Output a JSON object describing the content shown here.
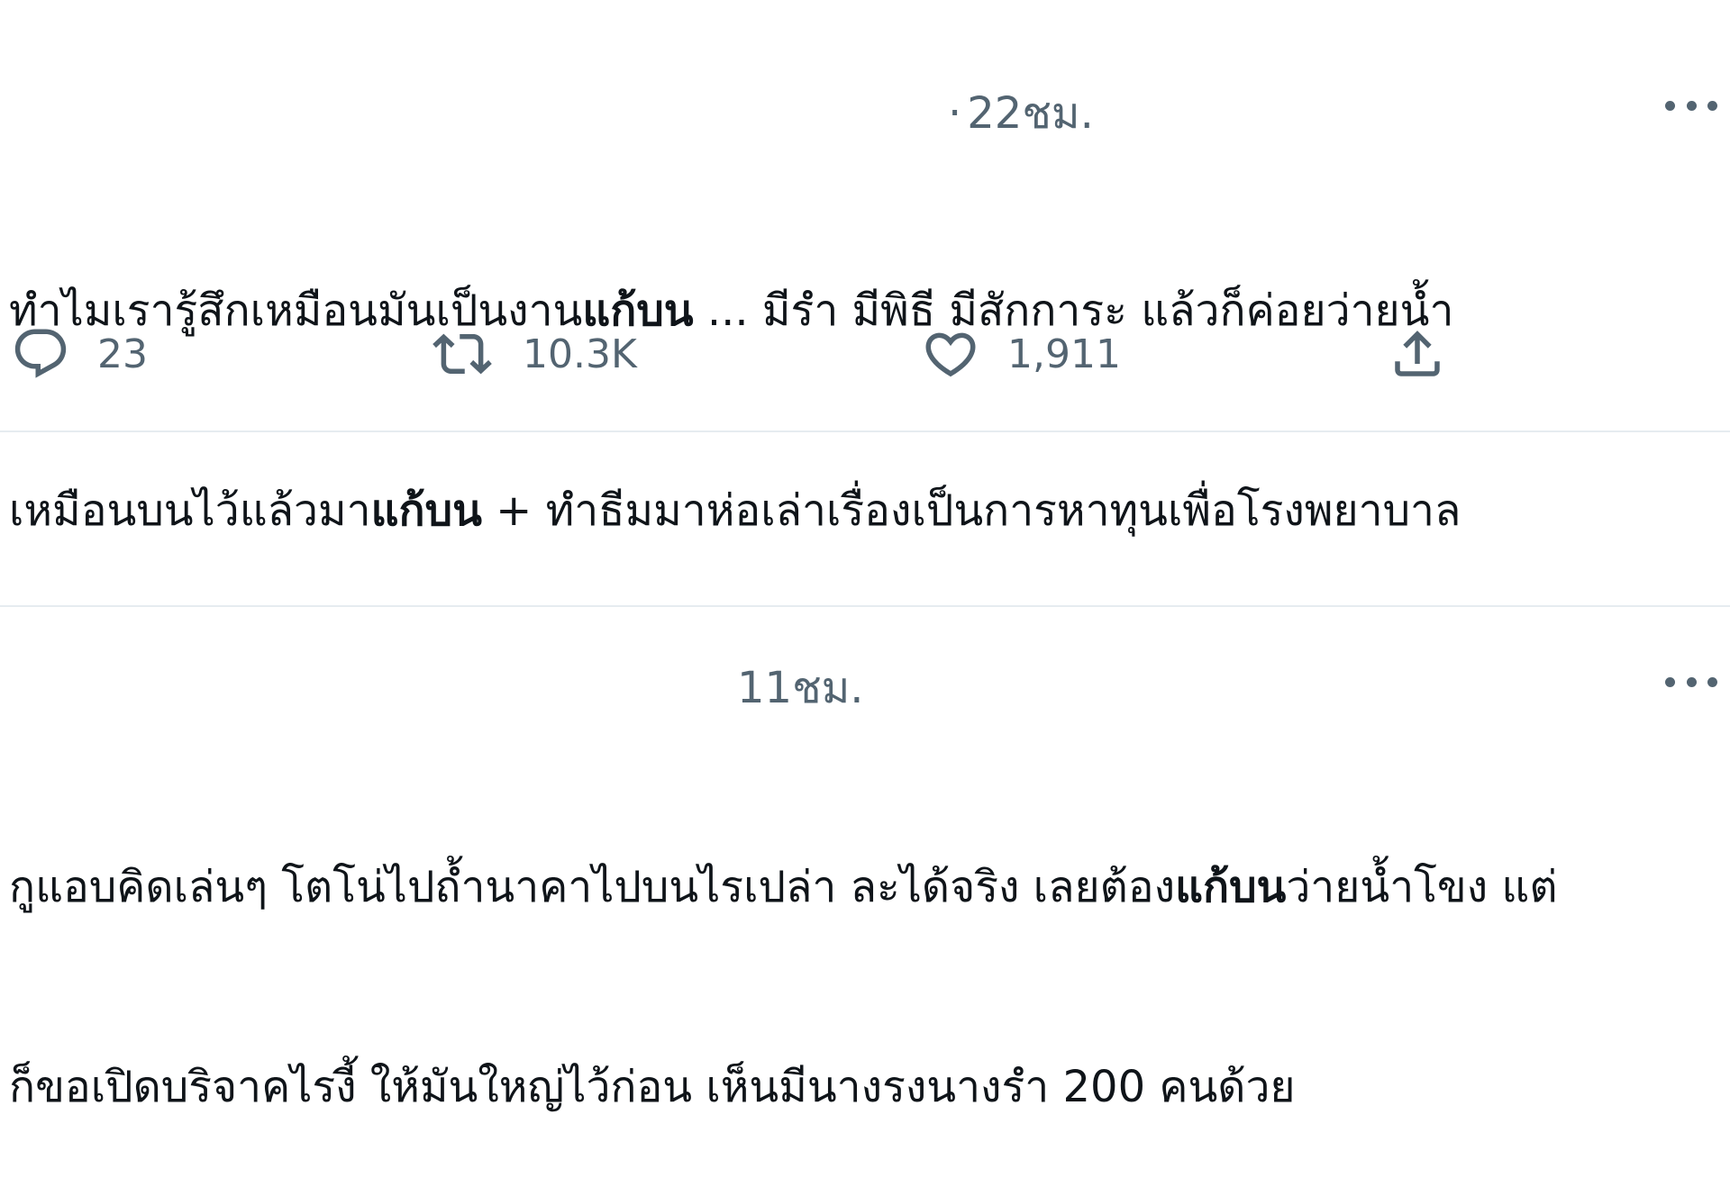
{
  "tweets": [
    {
      "time_separator": "·",
      "time": "22ชม.",
      "lines": [
        [
          {
            "text": "ทำไมเรารู้สึกเหมือนมันเป็นงาน",
            "bold": false
          },
          {
            "text": "แก้บน",
            "bold": true
          },
          {
            "text": " ... มีรำ มีพิธี มีสักการะ แล้วก็ค่อยว่ายน้ำ",
            "bold": false
          }
        ],
        [
          {
            "text": "เหมือนบนไว้แล้วมา",
            "bold": false
          },
          {
            "text": "แก้บน",
            "bold": true
          },
          {
            "text": " + ทำธีมมาห่อเล่าเรื่องเป็นการหาทุนเพื่อโรงพยาบาล",
            "bold": false
          }
        ]
      ],
      "actions": {
        "replies": "23",
        "retweets": "10.3K",
        "likes": "1,911"
      }
    },
    {
      "time": "11ชม.",
      "lines": [
        [
          {
            "text": "กูแอบคิดเล่นๆ โตโน่ไปถ้ำนาคาไปบนไรเปล่า ละได้จริง เลยต้อง",
            "bold": false
          },
          {
            "text": "แก้บน",
            "bold": true
          },
          {
            "text": "ว่ายน้ำโขง แต่",
            "bold": false
          }
        ],
        [
          {
            "text": "ก็ขอเปิดบริจาคไรงี้ ให้มันใหญ่ไว้ก่อน เห็นมีนางรงนางรำ 200 คนด้วย",
            "bold": false
          }
        ]
      ]
    }
  ],
  "icons": {
    "reply": "reply-icon",
    "retweet": "retweet-icon",
    "like": "heart-icon",
    "share": "share-icon",
    "more": "more-icon"
  },
  "colors": {
    "text": "#0f1419",
    "secondary": "#536471",
    "divider": "#e6ecf0"
  }
}
